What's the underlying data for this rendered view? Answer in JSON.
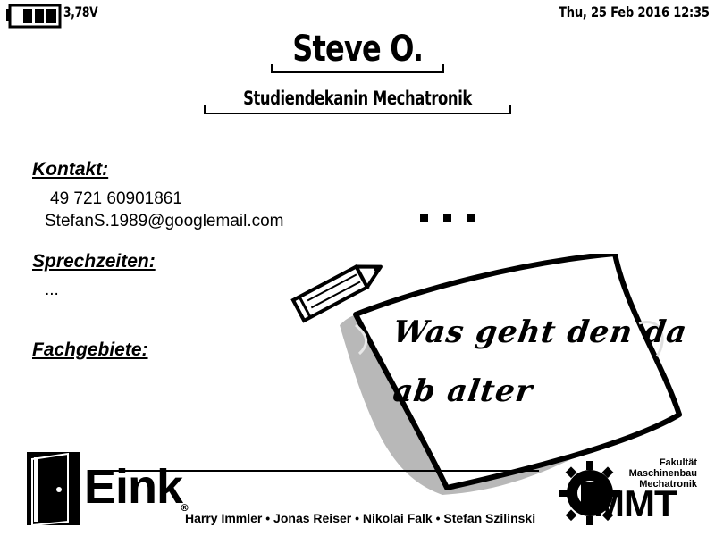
{
  "status": {
    "voltage": "3,78V",
    "datetime": "Thu, 25 Feb 2016 12:35"
  },
  "profile": {
    "name": "Steve O.",
    "role": "Studiendekanin Mechatronik"
  },
  "sections": {
    "contact_heading": "Kontakt:",
    "phone": "49 721 60901861",
    "email": "StefanS.1989@googlemail.com",
    "hours_heading": "Sprechzeiten:",
    "hours_value": "...",
    "fields_heading": "Fachgebiete:"
  },
  "note": {
    "line1": "Was geht den da",
    "line2": "ab alter"
  },
  "footer": {
    "eink_logo": "Eink",
    "authors": "Harry Immler • Jonas Reiser • Nikolai Falk • Stefan Szilinski",
    "mmt_caption_1": "Fakultät",
    "mmt_caption_2": "Maschinenbau",
    "mmt_caption_3": "Mechatronik",
    "mmt_logo": "MMT"
  }
}
